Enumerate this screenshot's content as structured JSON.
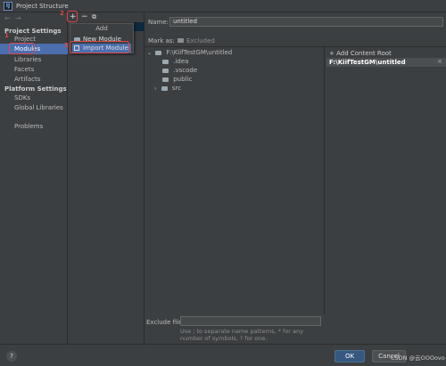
{
  "window": {
    "title": "Project Structure",
    "app_icon_text": "IJ"
  },
  "nav": {
    "back": "←",
    "forward": "→"
  },
  "sidebar": {
    "project_settings_header": "Project Settings",
    "project_items": [
      "Project",
      "Modules",
      "Libraries",
      "Facets",
      "Artifacts"
    ],
    "platform_settings_header": "Platform Settings",
    "platform_items": [
      "SDKs",
      "Global Libraries"
    ],
    "problems": "Problems"
  },
  "annotations": {
    "step1": "1",
    "step2": "2",
    "step3": "3"
  },
  "toolbar": {
    "add": "+",
    "remove": "−",
    "copy": "⧉"
  },
  "popup": {
    "title": "Add",
    "items": [
      "New Module",
      "Import Module"
    ]
  },
  "main": {
    "name_label": "Name:",
    "name_value": "untitled",
    "mark_as_label": "Mark as:",
    "excluded_label": "Excluded",
    "tree": {
      "root": "F:\\KiifTestGM\\untitled",
      "children": [
        ".idea",
        ".vscode",
        "public",
        "src"
      ]
    },
    "add_content_root": "+ Add Content Root",
    "content_root_path": "F:\\KiifTestGM\\untitled",
    "exclude_files_label": "Exclude files:",
    "exclude_files_value": "",
    "exclude_hint": "Use ; to separate name patterns, * for any number of symbols, ? for one."
  },
  "buttons": {
    "ok": "OK",
    "cancel": "Cancel",
    "help": "?"
  },
  "watermark": "CSDN @云OOOovo",
  "colors": {
    "background": "#3c3f41",
    "selection": "#4b6eaf",
    "annotation_red": "#e04848",
    "ok_button": "#365880"
  }
}
